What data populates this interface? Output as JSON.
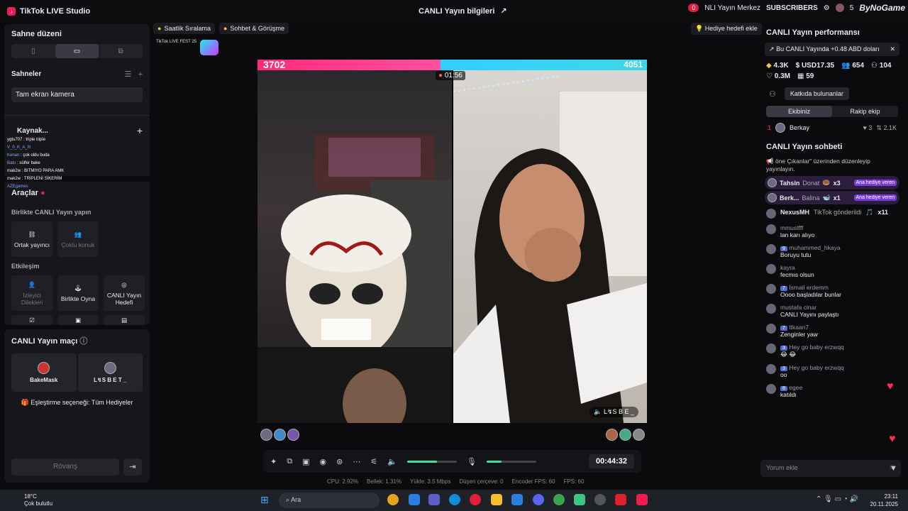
{
  "app": {
    "title": "TikTok LIVE Studio",
    "center_title": "CANLI Yayın bilgileri"
  },
  "topright": {
    "notif_count": "0",
    "merkez": "NLI Yayın Merkez",
    "subscribers": "SUBSCRIBERS",
    "minus": "5",
    "brand": "ByNoGame"
  },
  "left": {
    "scene_layout_title": "Sahne düzeni",
    "scenes_title": "Sahneler",
    "scene_item": "Tam ekran kamera",
    "sources_title": "Kaynak...",
    "tools_title": "Araçlar",
    "collab_title": "Birlikte CANLI Yayın yapın",
    "cohost": "Ortak yayıncı",
    "multi": "Çoklu konuk",
    "interaction": "Etkileşim",
    "viewer_requests": "İzleyici Dilekleri",
    "play_together": "Birlikte Oyna",
    "live_goal": "CANLI Yayın Hedefi",
    "match_title": "CANLI Yayın maçı",
    "player_left": "BakeMask",
    "player_right": "L↯S B E T _",
    "match_option": "Eşleştirme seçeneği: Tüm Hediyeler",
    "rematch": "Rövanş",
    "chat_overlay": [
      {
        "n": "ygtu707",
        "t": "triple triple"
      },
      {
        "n": "V_0_K_A_N",
        "t": ""
      },
      {
        "n": "Kenan",
        "t": "çok oldu buda"
      },
      {
        "n": "Batu",
        "t": "sülfer bake"
      },
      {
        "n": "mak2w",
        "t": "BITMIYO PARA AMK"
      },
      {
        "n": "mak2w",
        "t": "TRİPLENİ SİKERİM"
      },
      {
        "n": "AZEgames",
        "t": ""
      }
    ]
  },
  "tags": {
    "hourly": "Saatlik Sıralama",
    "chat": "Sohbet & Görüşme",
    "gift_goal": "Hediye hedefi ekle",
    "fest": "TikTok LIVE FEST 25"
  },
  "stage": {
    "score_left": "3702",
    "score_right": "4051",
    "timer": "01:56",
    "right_name": "L↯S B E _"
  },
  "controls": {
    "clock": "00:44:32"
  },
  "stats": {
    "cpu": "CPU: 2.92%",
    "mem": "Bellek: 1.31%",
    "upload": "Yükle: 3.5 Mbps",
    "drop": "Düşen çerçeve: 0",
    "encfps": "Encoder FPS: 60",
    "fps": "FPS: 60"
  },
  "right": {
    "perf_title": "CANLI Yayın performansı",
    "earnings": "Bu CANLI Yayında +0.48 ABD doları",
    "m1": "4.3K",
    "m2": "USD17.35",
    "m3": "654",
    "m4": "104",
    "m5": "0.3M",
    "m6": "59",
    "contrib": "Katkıda bulunanlar",
    "team_ours": "Ekibiniz",
    "team_rival": "Rakip ekip",
    "lead_rank": "1",
    "lead_name": "Berkay",
    "lead_hearts": "3",
    "lead_score": "2.1K",
    "chat_title": "CANLI Yayın sohbeti",
    "pinned": "öne Çıkanlar\" üzerinden düzenleyip yayınlayın.",
    "gifts": [
      {
        "name": "Tahsin",
        "gift": "Donat",
        "x": "x3",
        "badge": "Ana hediye veren"
      },
      {
        "name": "Berk...",
        "gift": "Balina",
        "x": "x1",
        "badge": "Ana hediye veren"
      }
    ],
    "nexus_name": "NexusMH",
    "nexus_text": "TikTok gönderildi",
    "nexus_x": "x11",
    "messages": [
      {
        "lvl": "",
        "who": "mmustfff",
        "txt": "lan karı alıyo"
      },
      {
        "lvl": "9",
        "who": "muhammed_hkaya",
        "txt": "Boruyu tutu"
      },
      {
        "lvl": "",
        "who": "kayra",
        "txt": "fecmıs olsun"
      },
      {
        "lvl": "7",
        "who": "İsmail erdemm",
        "txt": "Oooo başladılar bunlar"
      },
      {
        "lvl": "",
        "who": "mustafa cinar",
        "txt": "CANLI Yayını paylaştı"
      },
      {
        "lvl": "7",
        "who": "ttkaan7",
        "txt": "Zenginler yaw"
      },
      {
        "lvl": "3",
        "who": "Hey go baby erzwqq",
        "txt": "😂 😂"
      },
      {
        "lvl": "3",
        "who": "Hey go baby erzwqq",
        "txt": "oo"
      },
      {
        "lvl": "8",
        "who": "egee",
        "txt": "katıldı"
      }
    ],
    "comment_placeholder": "Yorum ekle"
  },
  "taskbar": {
    "temp": "18°C",
    "weather": "Çok bulutlu",
    "search": "Ara",
    "time": "23:11",
    "date": "20.11.2025"
  }
}
